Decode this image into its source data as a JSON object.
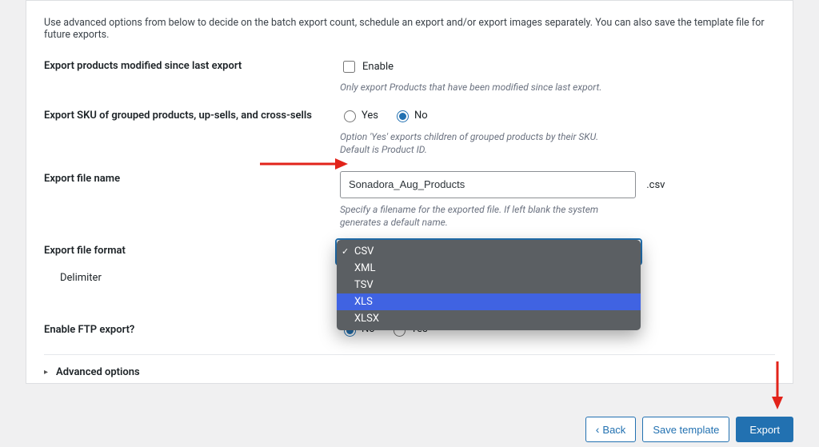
{
  "intro": "Use advanced options from below to decide on the batch export count, schedule an export and/or export images separately. You can also save the template file for future exports.",
  "rows": {
    "modified": {
      "label": "Export products modified since last export",
      "enable": "Enable",
      "helper": "Only export Products that have been modified since last export."
    },
    "sku": {
      "label": "Export SKU of grouped products, up-sells, and cross-sells",
      "yes": "Yes",
      "no": "No",
      "helper": "Option 'Yes' exports children of grouped products by their SKU. Default is Product ID."
    },
    "filename": {
      "label": "Export file name",
      "value": "Sonadora_Aug_Products",
      "ext": ".csv",
      "helper": "Specify a filename for the exported file. If left blank the system generates a default name."
    },
    "format": {
      "label": "Export file format",
      "options": [
        "CSV",
        "XML",
        "TSV",
        "XLS",
        "XLSX"
      ],
      "selected": "CSV",
      "highlighted": "XLS"
    },
    "delimiter": {
      "label": "Delimiter"
    },
    "ftp": {
      "label": "Enable FTP export?",
      "no": "No",
      "yes": "Yes"
    },
    "advanced": {
      "label": "Advanced options"
    }
  },
  "footer": {
    "back": "Back",
    "save": "Save template",
    "export": "Export"
  }
}
